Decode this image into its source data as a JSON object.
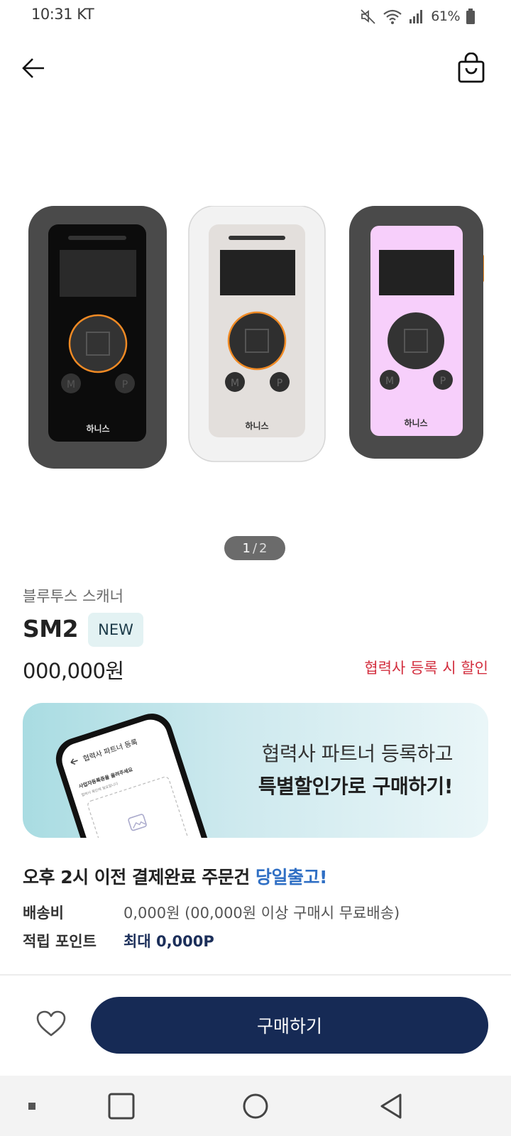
{
  "status_bar": {
    "time": "10:31 KT",
    "battery_text": "61%",
    "icons": [
      "mute-icon",
      "wifi-icon",
      "signal-icon",
      "battery-icon"
    ]
  },
  "app_bar": {
    "back_icon": "arrow-left-icon",
    "cart_icon": "shopping-bag-icon"
  },
  "gallery": {
    "current": "1",
    "separator": "/",
    "total": "2",
    "device_logo": "하니스",
    "button_labels": [
      "M",
      "P"
    ],
    "colors": [
      "#4a4a4a",
      "#f2f2f2",
      "#f7cffb"
    ],
    "accent": "#f08a24"
  },
  "product": {
    "category": "블루투스 스캐너",
    "name": "SM2",
    "badge": "NEW",
    "price": "000,000원",
    "partner_discount": "협력사 등록 시 할인"
  },
  "banner": {
    "line1": "협력사 파트너 등록하고",
    "line2": "특별할인가로 구매하기!",
    "phone_title": "협력사 파트너 등록",
    "phone_subtitle": "사업자등록증을 올려주세요",
    "phone_hint": "협력사 확인에 필요합니다"
  },
  "shipping": {
    "note_prefix": "오후 2시 이전 결제완료 주문건",
    "note_highlight": "당일출고!",
    "fee_label": "배송비",
    "fee_value": "0,000원 (00,000원 이상 구매시 무료배송)",
    "points_label": "적립 포인트",
    "points_value": "최대 0,000P"
  },
  "actions": {
    "wish_icon": "heart-icon",
    "buy_label": "구매하기"
  },
  "colors": {
    "primary": "#162a55",
    "discount": "#d32f3f",
    "highlight": "#2f6fc4",
    "badge_bg": "#e3f2f3"
  }
}
